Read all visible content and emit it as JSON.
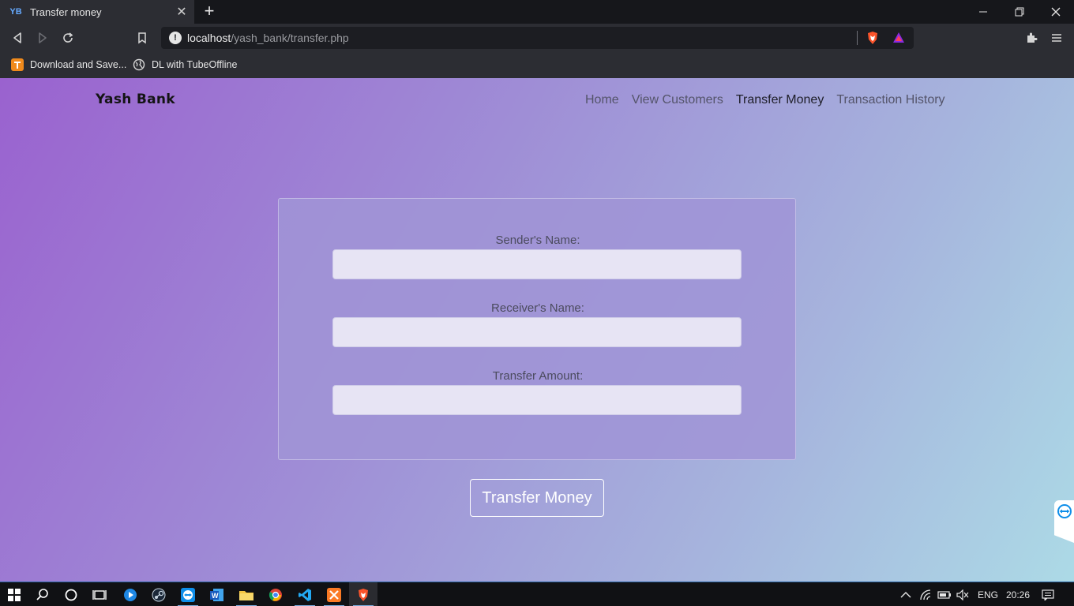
{
  "browser": {
    "tab_title": "Transfer money",
    "tab_favicon": "YB",
    "url_host": "localhost",
    "url_path": "/yash_bank/transfer.php",
    "bookmarks": [
      {
        "label": "Download and Save...",
        "icon": "tubeoffline-icon"
      },
      {
        "label": "DL with TubeOffline",
        "icon": "globe-icon"
      }
    ]
  },
  "page": {
    "brand": "Yash Bank",
    "nav": [
      {
        "label": "Home",
        "active": false
      },
      {
        "label": "View Customers",
        "active": false
      },
      {
        "label": "Transfer Money",
        "active": true
      },
      {
        "label": "Transaction History",
        "active": false
      }
    ],
    "form": {
      "sender_label": "Sender's Name:",
      "sender_value": "",
      "receiver_label": "Receiver's Name:",
      "receiver_value": "",
      "amount_label": "Transfer Amount:",
      "amount_value": "",
      "submit_label": "Transfer Money"
    }
  },
  "taskbar": {
    "language": "ENG",
    "time": "20:26"
  },
  "colors": {
    "gradient_start": "#9a62cf",
    "gradient_end": "#acdae6",
    "brave_orange": "#fb542b"
  }
}
